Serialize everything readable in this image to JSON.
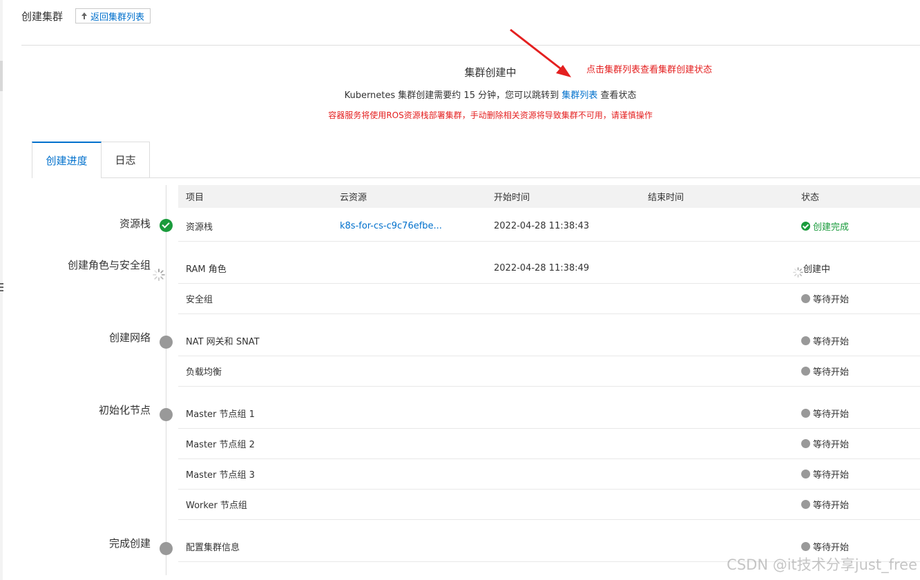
{
  "header": {
    "title": "创建集群",
    "back_label": "返回集群列表"
  },
  "status": {
    "title": "集群创建中",
    "desc_prefix": "Kubernetes 集群创建需要约 15 分钟，您可以跳转到 ",
    "desc_link": "集群列表",
    "desc_suffix": " 查看状态",
    "warning": "容器服务将使用ROS资源栈部署集群，手动删除相关资源将导致集群不可用，请谨慎操作"
  },
  "annotation": {
    "text": "点击集群列表查看集群创建状态",
    "color": "#e42020"
  },
  "tabs": [
    {
      "label": "创建进度",
      "active": true
    },
    {
      "label": "日志",
      "active": false
    }
  ],
  "steps": [
    {
      "label": "资源栈",
      "state": "done"
    },
    {
      "label": "创建角色与安全组",
      "state": "loading"
    },
    {
      "label": "创建网络",
      "state": "waiting"
    },
    {
      "label": "初始化节点",
      "state": "waiting"
    },
    {
      "label": "完成创建",
      "state": "waiting"
    }
  ],
  "table": {
    "columns": [
      "项目",
      "云资源",
      "开始时间",
      "结束时间",
      "状态"
    ],
    "rows": [
      {
        "item": "资源栈",
        "resource": "k8s-for-cs-c9c76efbe...",
        "start": "2022-04-28 11:38:43",
        "end": "",
        "status": "创建完成",
        "status_type": "done"
      },
      {
        "item": "RAM 角色",
        "resource": "",
        "start": "2022-04-28 11:38:49",
        "end": "",
        "status": "创建中",
        "status_type": "loading"
      },
      {
        "item": "安全组",
        "resource": "",
        "start": "",
        "end": "",
        "status": "等待开始",
        "status_type": "waiting"
      },
      {
        "item": "NAT 网关和 SNAT",
        "resource": "",
        "start": "",
        "end": "",
        "status": "等待开始",
        "status_type": "waiting"
      },
      {
        "item": "负载均衡",
        "resource": "",
        "start": "",
        "end": "",
        "status": "等待开始",
        "status_type": "waiting"
      },
      {
        "item": "Master 节点组 1",
        "resource": "",
        "start": "",
        "end": "",
        "status": "等待开始",
        "status_type": "waiting"
      },
      {
        "item": "Master 节点组 2",
        "resource": "",
        "start": "",
        "end": "",
        "status": "等待开始",
        "status_type": "waiting"
      },
      {
        "item": "Master 节点组 3",
        "resource": "",
        "start": "",
        "end": "",
        "status": "等待开始",
        "status_type": "waiting"
      },
      {
        "item": "Worker 节点组",
        "resource": "",
        "start": "",
        "end": "",
        "status": "等待开始",
        "status_type": "waiting"
      },
      {
        "item": "配置集群信息",
        "resource": "",
        "start": "",
        "end": "",
        "status": "等待开始",
        "status_type": "waiting"
      }
    ]
  },
  "colors": {
    "link": "#0070cc",
    "success": "#1a9b3c",
    "waiting": "#999999",
    "warning": "#e42020"
  },
  "watermark": "CSDN @it技术分享just_free"
}
